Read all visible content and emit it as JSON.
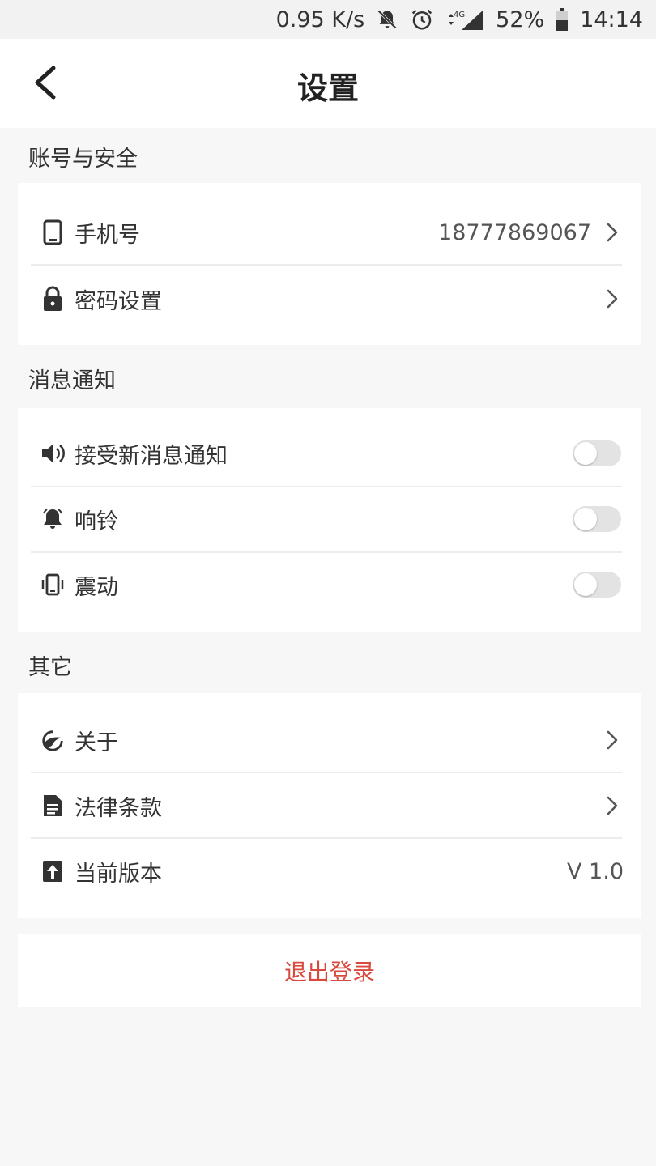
{
  "status_bar": {
    "speed": "0.95 K/s",
    "network": "4G",
    "battery": "52%",
    "time": "14:14"
  },
  "header": {
    "title": "设置"
  },
  "sections": {
    "account": {
      "title": "账号与安全",
      "phone_label": "手机号",
      "phone_value": "18777869067",
      "password_label": "密码设置"
    },
    "notify": {
      "title": "消息通知",
      "new_msg_label": "接受新消息通知",
      "ring_label": "响铃",
      "vibrate_label": "震动"
    },
    "other": {
      "title": "其它",
      "about_label": "关于",
      "legal_label": "法律条款",
      "version_label": "当前版本",
      "version_value": "V 1.0"
    }
  },
  "logout": {
    "label": "退出登录"
  },
  "colors": {
    "accent_red": "#d84a3e",
    "toggle_off": "#e3e3e3",
    "background": "#f7f7f7"
  }
}
